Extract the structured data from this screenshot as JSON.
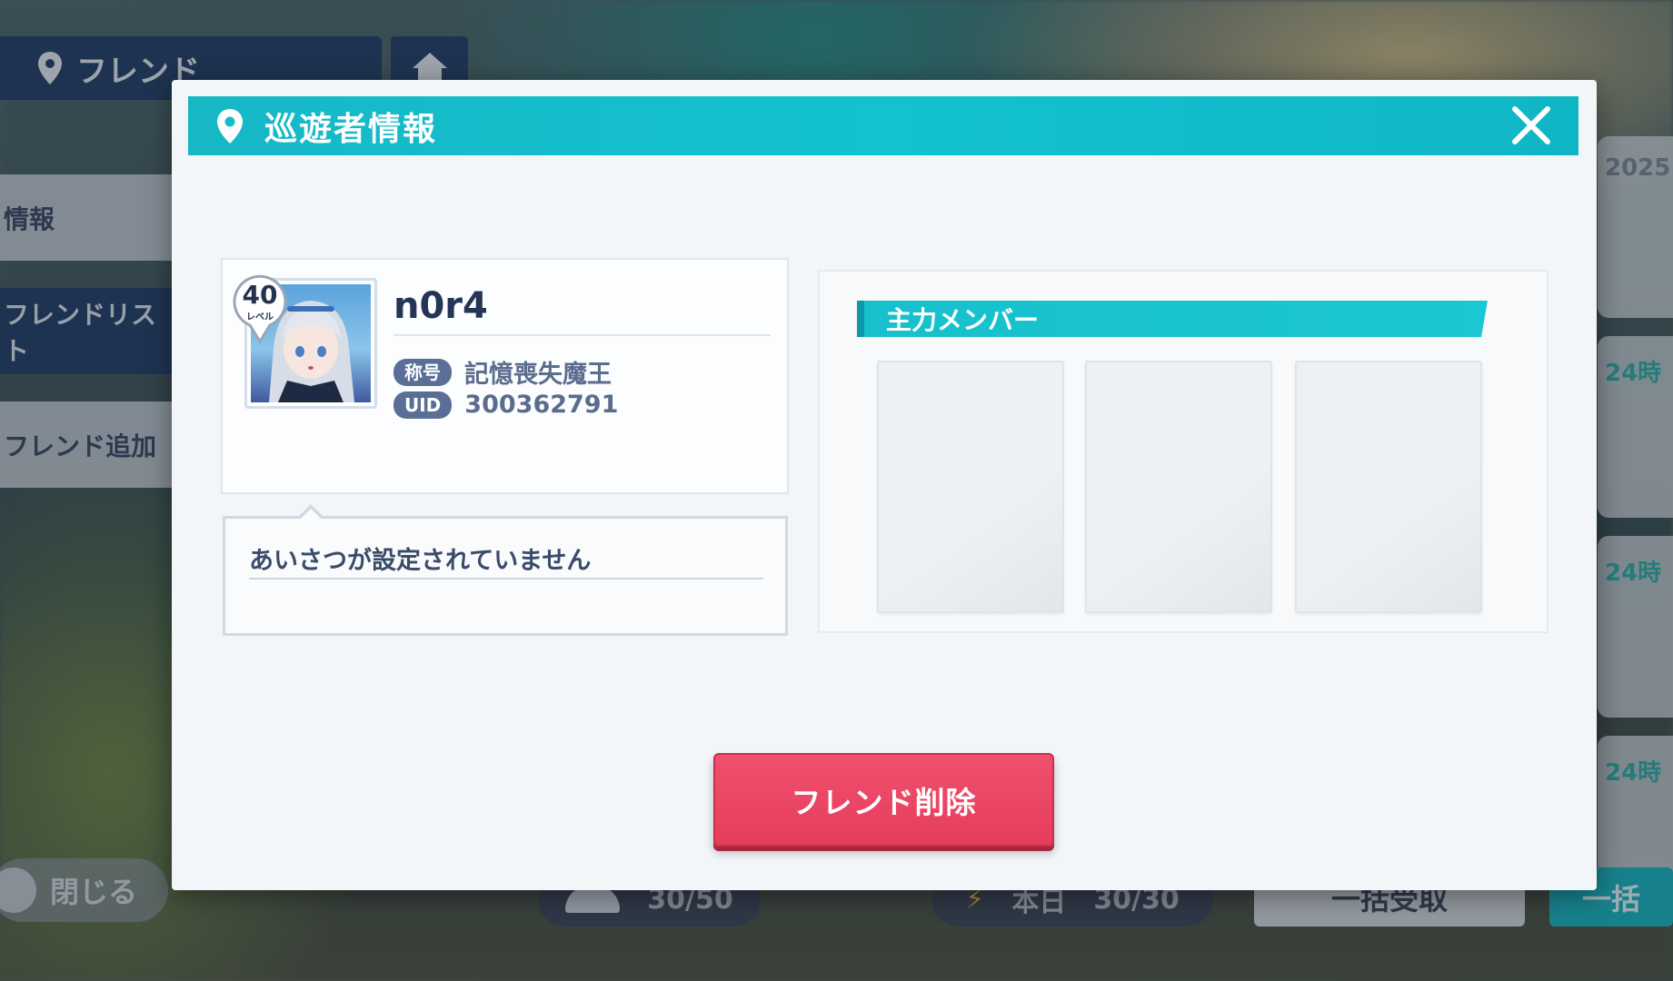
{
  "background": {
    "header_title": "フレンド",
    "side_tabs": [
      "情報",
      "フレンドリスト",
      "フレンド追加"
    ],
    "close_label": "閉じる",
    "right_cards": [
      "2025",
      "24時",
      "24時",
      "24時"
    ],
    "bottom": {
      "stat1": "30/50",
      "stat2_label": "本日",
      "stat2_value": "30/30",
      "button1": "一括受取",
      "button2": "一括"
    }
  },
  "modal": {
    "title": "巡遊者情報",
    "profile": {
      "level": "40",
      "level_label": "レベル",
      "username": "n0r4",
      "title_tag": "称号",
      "title_value": "記憶喪失魔王",
      "uid_tag": "UID",
      "uid_value": "300362791"
    },
    "greeting": "あいさつが設定されていません",
    "members_header": "主力メンバー",
    "delete_button": "フレンド削除"
  },
  "colors": {
    "accent_teal": "#12c2cf",
    "delete_red": "#e53d5c",
    "navy": "#24416b"
  }
}
